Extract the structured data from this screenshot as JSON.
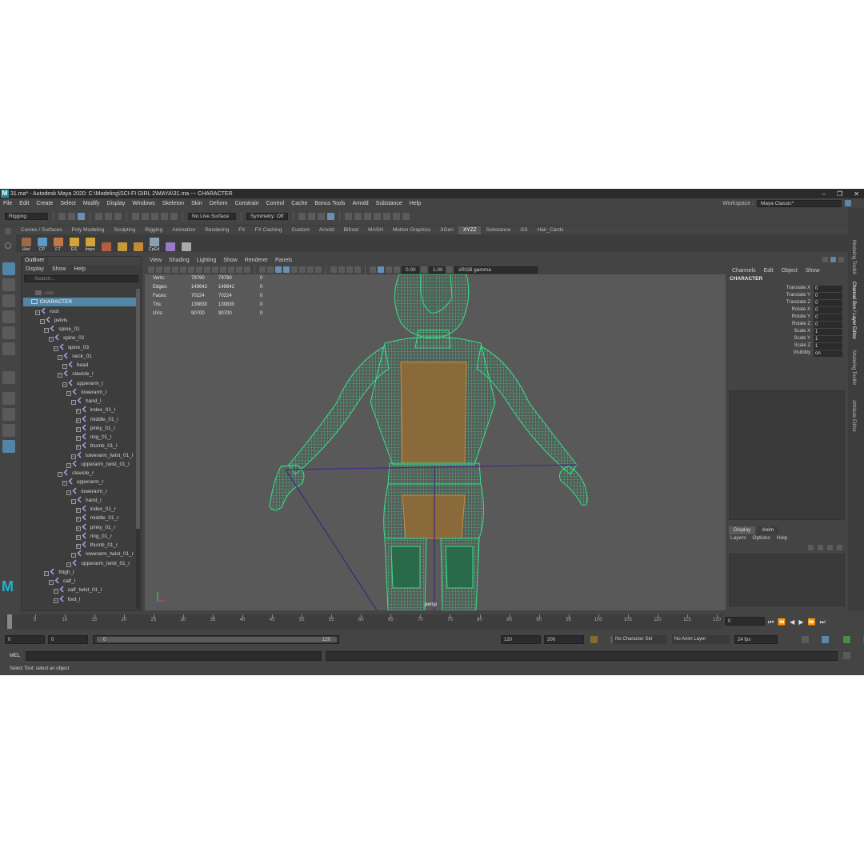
{
  "window": {
    "title": "31.ma* - Autodesk Maya 2020: C:\\Modeling\\SCI-FI GIRL 2\\MAYA\\31.ma  ---  CHARACTER",
    "logo_letter": "M",
    "minimize": "–",
    "maximize": "❐",
    "close": "✕"
  },
  "menubar": {
    "items": [
      "File",
      "Edit",
      "Create",
      "Select",
      "Modify",
      "Display",
      "Windows",
      "Skeleton",
      "Skin",
      "Deform",
      "Constrain",
      "Control",
      "Cache",
      "Bonus Tools",
      "Arnold",
      "Substance",
      "Help"
    ],
    "workspace_label": "Workspace :",
    "workspace_value": "Maya Classic*"
  },
  "statusline": {
    "menuset": "Rigging",
    "live_surface": "No Live Surface",
    "symmetry": "Symmetry: Off"
  },
  "shelf": {
    "tabs": [
      "Curves / Surfaces",
      "Poly Modeling",
      "Sculpting",
      "Rigging",
      "Animation",
      "Rendering",
      "FX",
      "FX Caching",
      "Custom",
      "Arnold",
      "Bifrost",
      "MASH",
      "Motion Graphics",
      "XGen",
      "XYZZ",
      "Substance",
      "GS",
      "Hair_Cards"
    ],
    "active_tab": "XYZZ",
    "buttons": [
      "Hist",
      "CP",
      "FT",
      "ES",
      "Impo",
      "",
      "",
      "",
      "CpEd",
      "",
      ""
    ]
  },
  "outliner": {
    "tab": "Outliner",
    "menu": [
      "Display",
      "Show",
      "Help"
    ],
    "search_placeholder": "Search...",
    "rows": [
      {
        "label": "side",
        "depth": 2,
        "kind": "cam",
        "state": "dim"
      },
      {
        "label": "CHARACTER",
        "depth": 1,
        "kind": "group",
        "state": "selected"
      },
      {
        "label": "root",
        "depth": 2,
        "kind": "joint"
      },
      {
        "label": "pelvis",
        "depth": 3,
        "kind": "joint"
      },
      {
        "label": "spine_01",
        "depth": 4,
        "kind": "joint"
      },
      {
        "label": "spine_02",
        "depth": 5,
        "kind": "joint"
      },
      {
        "label": "spine_03",
        "depth": 6,
        "kind": "joint"
      },
      {
        "label": "neck_01",
        "depth": 7,
        "kind": "joint"
      },
      {
        "label": "head",
        "depth": 8,
        "kind": "joint"
      },
      {
        "label": "clavicle_l",
        "depth": 7,
        "kind": "joint"
      },
      {
        "label": "upperarm_l",
        "depth": 8,
        "kind": "joint"
      },
      {
        "label": "lowerarm_l",
        "depth": 9,
        "kind": "joint"
      },
      {
        "label": "hand_l",
        "depth": 10,
        "kind": "joint"
      },
      {
        "label": "index_01_l",
        "depth": 11,
        "kind": "joint",
        "expand": true
      },
      {
        "label": "middle_01_l",
        "depth": 11,
        "kind": "joint",
        "expand": true
      },
      {
        "label": "pinky_01_l",
        "depth": 11,
        "kind": "joint",
        "expand": true
      },
      {
        "label": "ring_01_l",
        "depth": 11,
        "kind": "joint",
        "expand": true
      },
      {
        "label": "thumb_01_l",
        "depth": 11,
        "kind": "joint",
        "expand": true
      },
      {
        "label": "lowerarm_twist_01_l",
        "depth": 10,
        "kind": "joint"
      },
      {
        "label": "upperarm_twist_01_l",
        "depth": 9,
        "kind": "joint"
      },
      {
        "label": "clavicle_r",
        "depth": 7,
        "kind": "joint"
      },
      {
        "label": "upperarm_r",
        "depth": 8,
        "kind": "joint"
      },
      {
        "label": "lowerarm_r",
        "depth": 9,
        "kind": "joint"
      },
      {
        "label": "hand_r",
        "depth": 10,
        "kind": "joint"
      },
      {
        "label": "index_01_r",
        "depth": 11,
        "kind": "joint",
        "expand": true
      },
      {
        "label": "middle_01_r",
        "depth": 11,
        "kind": "joint",
        "expand": true
      },
      {
        "label": "pinky_01_r",
        "depth": 11,
        "kind": "joint",
        "expand": true
      },
      {
        "label": "ring_01_r",
        "depth": 11,
        "kind": "joint",
        "expand": true
      },
      {
        "label": "thumb_01_r",
        "depth": 11,
        "kind": "joint",
        "expand": true
      },
      {
        "label": "lowerarm_twist_01_r",
        "depth": 10,
        "kind": "joint"
      },
      {
        "label": "upperarm_twist_01_r",
        "depth": 9,
        "kind": "joint"
      },
      {
        "label": "thigh_l",
        "depth": 4,
        "kind": "joint"
      },
      {
        "label": "calf_l",
        "depth": 5,
        "kind": "joint"
      },
      {
        "label": "calf_twist_01_l",
        "depth": 6,
        "kind": "joint"
      },
      {
        "label": "foot_l",
        "depth": 6,
        "kind": "joint"
      }
    ]
  },
  "viewport": {
    "menu": [
      "View",
      "Shading",
      "Lighting",
      "Show",
      "Renderer",
      "Panels"
    ],
    "exposure": "0.00",
    "gamma": "1.00",
    "colorspace": "sRGB gamma",
    "hud": [
      {
        "label": "Verts:",
        "a": "79790",
        "b": "79790",
        "c": "0"
      },
      {
        "label": "Edges:",
        "a": "149642",
        "b": "149642",
        "c": "0"
      },
      {
        "label": "Faces:",
        "a": "70224",
        "b": "70224",
        "c": "0"
      },
      {
        "label": "Tris:",
        "a": "139830",
        "b": "139830",
        "c": "0"
      },
      {
        "label": "UVs:",
        "a": "90700",
        "b": "90700",
        "c": "0"
      }
    ],
    "camera": "persp",
    "wire_color": "#37e08a"
  },
  "channelbox": {
    "menu": [
      "Channels",
      "Edit",
      "Object",
      "Show"
    ],
    "object": "CHARACTER",
    "attributes": [
      {
        "name": "Translate X",
        "value": "0"
      },
      {
        "name": "Translate Y",
        "value": "0"
      },
      {
        "name": "Translate Z",
        "value": "0"
      },
      {
        "name": "Rotate X",
        "value": "0"
      },
      {
        "name": "Rotate Y",
        "value": "0"
      },
      {
        "name": "Rotate Z",
        "value": "0"
      },
      {
        "name": "Scale X",
        "value": "1"
      },
      {
        "name": "Scale Y",
        "value": "1"
      },
      {
        "name": "Scale Z",
        "value": "1"
      },
      {
        "name": "Visibility",
        "value": "on"
      }
    ],
    "layer_tabs": [
      "Display",
      "Anim"
    ],
    "layer_menu": [
      "Layers",
      "Options",
      "Help"
    ]
  },
  "side_tabs": [
    "Modeling Toolkit",
    "Channel Box / Layer Editor",
    "Attribute Editor"
  ],
  "timeline": {
    "ticks": [
      "1",
      "5",
      "10",
      "15",
      "20",
      "25",
      "30",
      "35",
      "40",
      "45",
      "50",
      "55",
      "60",
      "65",
      "70",
      "75",
      "80",
      "85",
      "90",
      "95",
      "100",
      "105",
      "110",
      "115",
      "120"
    ],
    "current_frame": "0",
    "play_buttons": [
      "⏮",
      "⏪",
      "◀",
      "▶",
      "⏩",
      "⏭"
    ]
  },
  "range": {
    "start": "0",
    "inner_start": "0",
    "slider_start": "0",
    "slider_end": "120",
    "inner_end": "120",
    "end": "200",
    "character_set": "No Character Set",
    "anim_layer": "No Anim Layer",
    "fps": "24 fps"
  },
  "cmdline": {
    "label": "MEL"
  },
  "helpline": {
    "text": "Select Tool: select an object"
  }
}
